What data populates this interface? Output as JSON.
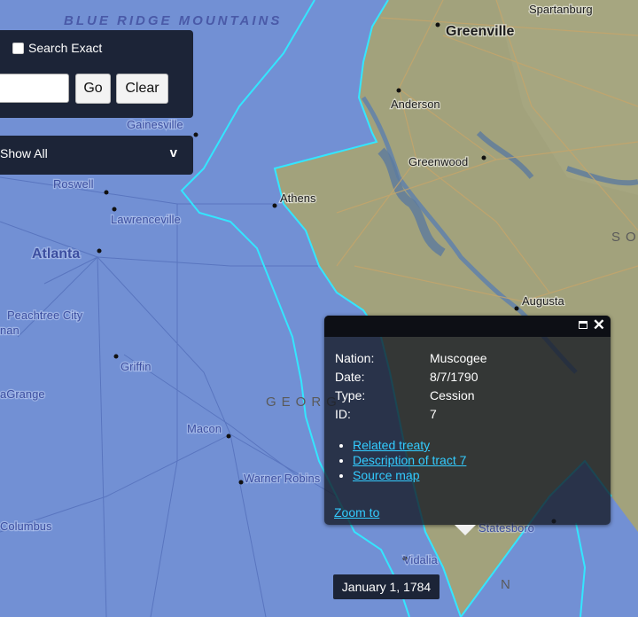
{
  "map": {
    "places": [
      {
        "key": "spartanburg",
        "label": "Spartanburg"
      },
      {
        "key": "greenville",
        "label": "Greenville"
      },
      {
        "key": "anderson",
        "label": "Anderson"
      },
      {
        "key": "greenwood",
        "label": "Greenwood"
      },
      {
        "key": "athens",
        "label": "Athens"
      },
      {
        "key": "augusta",
        "label": "Augusta"
      },
      {
        "key": "gainesville",
        "label": "Gainesville"
      },
      {
        "key": "roswell",
        "label": "Roswell"
      },
      {
        "key": "lawrenceville",
        "label": "Lawrenceville"
      },
      {
        "key": "atlanta",
        "label": "Atlanta"
      },
      {
        "key": "peachtree",
        "label": "Peachtree City"
      },
      {
        "key": "nan",
        "label": "nan"
      },
      {
        "key": "griffin",
        "label": "Griffin"
      },
      {
        "key": "lagrange",
        "label": "aGrange"
      },
      {
        "key": "macon",
        "label": "Macon"
      },
      {
        "key": "warner",
        "label": "Warner Robins"
      },
      {
        "key": "columbus",
        "label": "Columbus"
      },
      {
        "key": "statesboro",
        "label": "Statesboro"
      },
      {
        "key": "vidalia",
        "label": "Vidalia"
      }
    ],
    "region_label": "BLUE RIDGE MOUNTAINS",
    "state_label_ga": "GEORG",
    "state_label_sc": "SO",
    "state_label_n": "N",
    "colors": {
      "land": "#9c9c7a",
      "cession": "#6f8fd8",
      "border": "#33e6ff",
      "water": "#6688aa"
    }
  },
  "search": {
    "exact_label": "Search Exact",
    "exact_checked": false,
    "input_value": "",
    "go_label": "Go",
    "clear_label": "Clear"
  },
  "filter": {
    "selected": "Show All",
    "chevron": "v"
  },
  "popup": {
    "rows": [
      {
        "key": "Nation:",
        "value": "Muscogee"
      },
      {
        "key": "Date:",
        "value": "8/7/1790"
      },
      {
        "key": "Type:",
        "value": "Cession"
      },
      {
        "key": "ID:",
        "value": "7"
      }
    ],
    "links": [
      "Related treaty",
      "Description of tract 7",
      "Source map"
    ],
    "zoom_label": "Zoom to",
    "close_glyph": "✕"
  },
  "timeline": {
    "date": "January 1, 1784"
  }
}
